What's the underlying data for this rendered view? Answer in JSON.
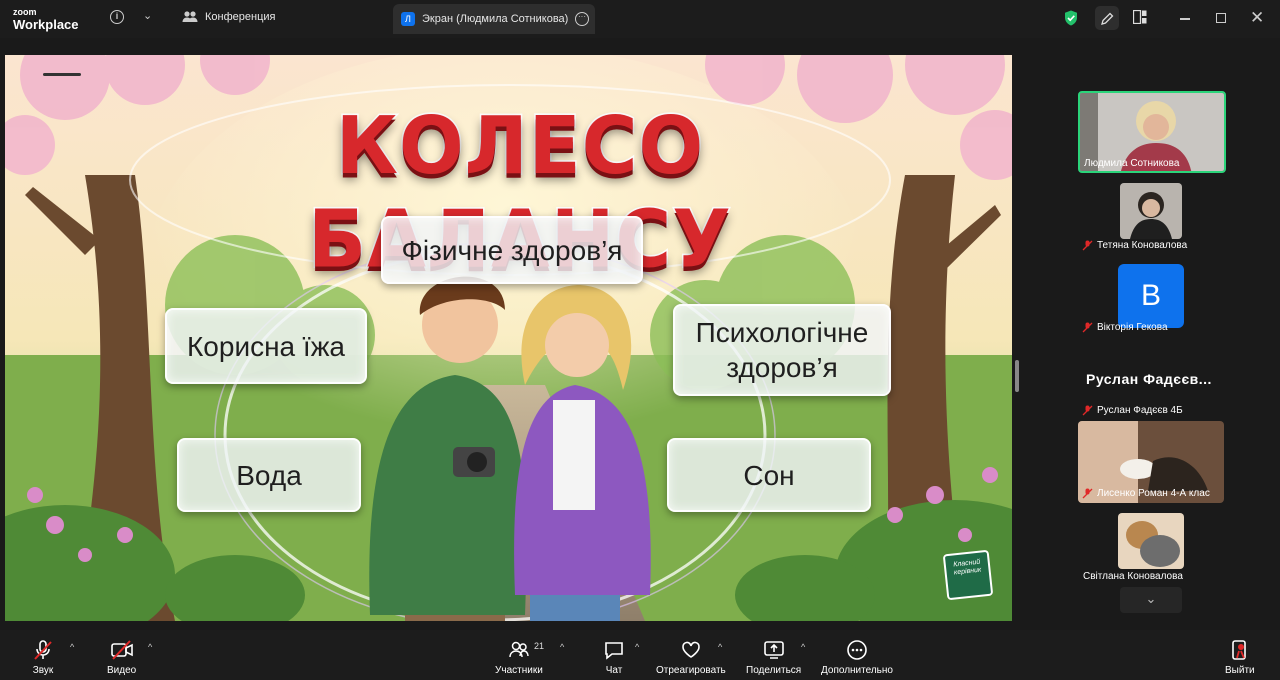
{
  "app": {
    "logo_line1": "zoom",
    "logo_line2": "Workplace"
  },
  "tabs": {
    "conference": "Конференция",
    "screen_badge": "Л",
    "screen": "Экран (Людмила Сотникова)"
  },
  "slide": {
    "title": "КОЛЕСО БАЛАНСУ",
    "cards": {
      "physical": "Фізичне здоров’я",
      "food": "Корисна їжа",
      "psych_line1": "Психологічне",
      "psych_line2": "здоров’я",
      "water": "Вода",
      "sleep": "Сон"
    },
    "sticker_line1": "Класний",
    "sticker_line2": "керівник"
  },
  "participants": {
    "speaker": "Людмила Сотникова",
    "p2": "Тетяна Коновалова",
    "p3_initial": "В",
    "p3": "Вікторія Гекова",
    "group_name": "Руслан  Фадєєв...",
    "p4": "Руслан Фадєєв 4Б",
    "p5": "Лисенко Роман 4-А клас",
    "p6": "Світлана Коновалова"
  },
  "toolbar": {
    "audio": "Звук",
    "video": "Видео",
    "participants": "Участники",
    "participants_count": "21",
    "chat": "Чат",
    "react": "Отреагировать",
    "share": "Поделиться",
    "more": "Дополнительно",
    "leave": "Выйти"
  },
  "colors": {
    "accent": "#0e72ed",
    "speaker_border": "#2bd47a",
    "leave": "#e02828",
    "title_red": "#d7282c"
  }
}
